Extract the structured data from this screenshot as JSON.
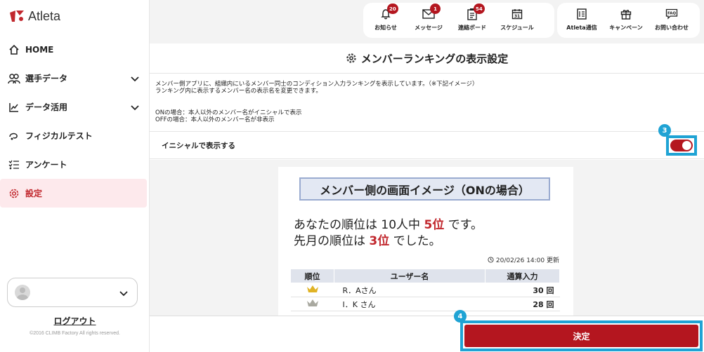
{
  "app": {
    "brand": "Atleta",
    "brand_color": "#c1272d",
    "accent_color": "#b4161f",
    "highlight_color": "#1fa3d4"
  },
  "sidebar": {
    "items": [
      {
        "label": "HOME",
        "icon": "home-icon"
      },
      {
        "label": "選手データ",
        "icon": "users-icon"
      },
      {
        "label": "データ活用",
        "icon": "chart-line-icon"
      },
      {
        "label": "フィジカルテスト",
        "icon": "physical-test-icon"
      },
      {
        "label": "アンケート",
        "icon": "survey-list-icon"
      },
      {
        "label": "設定",
        "icon": "gear-icon"
      }
    ],
    "logout": "ログアウト",
    "copyright": "©2016 CLIMB Factory All rights reserved."
  },
  "toolbar": {
    "group1": [
      {
        "label": "お知らせ",
        "badge": "20",
        "icon": "bell-icon"
      },
      {
        "label": "メッセージ",
        "badge": "1",
        "icon": "mail-icon"
      },
      {
        "label": "連絡ボード",
        "badge": "54",
        "icon": "clipboard-icon"
      },
      {
        "label": "スケジュール",
        "badge": "",
        "icon": "calendar-icon",
        "day": "31"
      }
    ],
    "group2": [
      {
        "label": "Atleta通信",
        "icon": "newsletter-icon"
      },
      {
        "label": "キャンペーン",
        "icon": "gift-icon"
      },
      {
        "label": "お問い合わせ",
        "icon": "faq-icon",
        "faq": "FAQ"
      }
    ]
  },
  "main": {
    "title": "メンバーランキングの表示設定",
    "desc_line1": "メンバー側アプリに、組織内にいるメンバー同士のコンディション入力ランキングを表示しています。（※下記イメージ）",
    "desc_line2": "ランキング内に表示するメンバー名の表示名を変更できます。",
    "on_desc": "ONの場合：本人以外のメンバー名がイニシャルで表示",
    "off_desc": "OFFの場合：本人以外のメンバー名が非表示",
    "toggle_label": "イニシャルで表示する",
    "toggle_on": true,
    "step3": "3",
    "step4": "4"
  },
  "preview": {
    "title": "メンバー側の画面イメージ（ONの場合）",
    "line1_prefix": "あなたの順位は 10人中 ",
    "line1_rank": "5位",
    "line1_suffix": " です。",
    "line2_prefix": "先月の順位は ",
    "line2_rank": "3位",
    "line2_suffix": " でした。",
    "updated": "20/02/26 14:00 更新",
    "headers": [
      "順位",
      "ユーザー名",
      "通算入力"
    ],
    "rows": [
      {
        "crown": "gold-crown-icon",
        "name": "R．Aさん",
        "score": "30 回"
      },
      {
        "crown": "silver-crown-icon",
        "name": "I．K さん",
        "score": "28 回"
      }
    ]
  },
  "footer": {
    "submit": "決定"
  }
}
